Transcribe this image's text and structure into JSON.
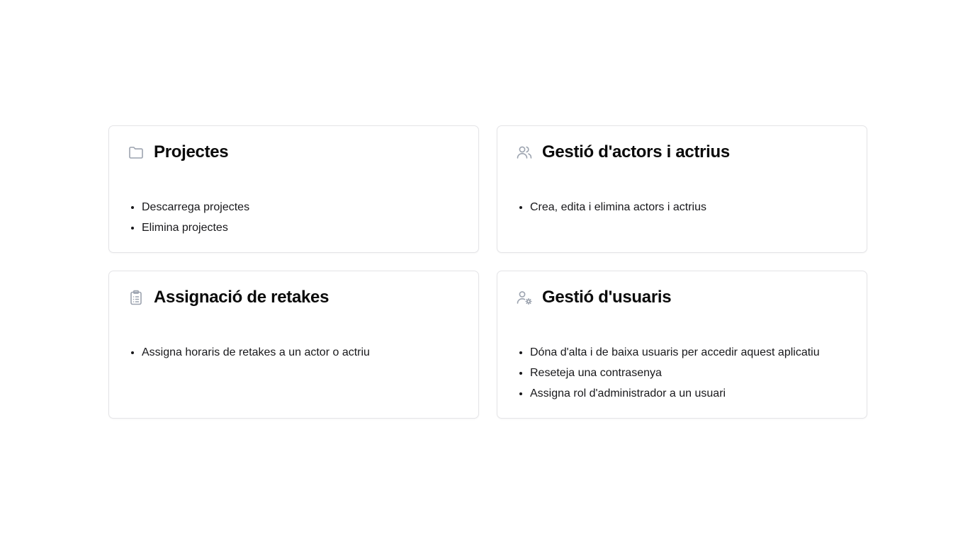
{
  "cards": [
    {
      "icon": "folder-icon",
      "title": "Projectes",
      "items": [
        "Descarrega projectes",
        "Elimina projectes"
      ]
    },
    {
      "icon": "users-icon",
      "title": "Gestió d'actors i actrius",
      "items": [
        "Crea, edita i elimina actors i actrius"
      ]
    },
    {
      "icon": "clipboard-list-icon",
      "title": "Assignació de retakes",
      "items": [
        "Assigna horaris de retakes a un actor o actriu"
      ]
    },
    {
      "icon": "user-cog-icon",
      "title": "Gestió d'usuaris",
      "items": [
        "Dóna d'alta i de baixa usuaris per accedir aquest aplicatiu",
        "Reseteja una contrasenya",
        "Assigna rol d'administrador a un usuari"
      ]
    }
  ],
  "colors": {
    "border": "#e4e4e7",
    "icon": "#9ca3af",
    "text": "#0a0a0a"
  }
}
